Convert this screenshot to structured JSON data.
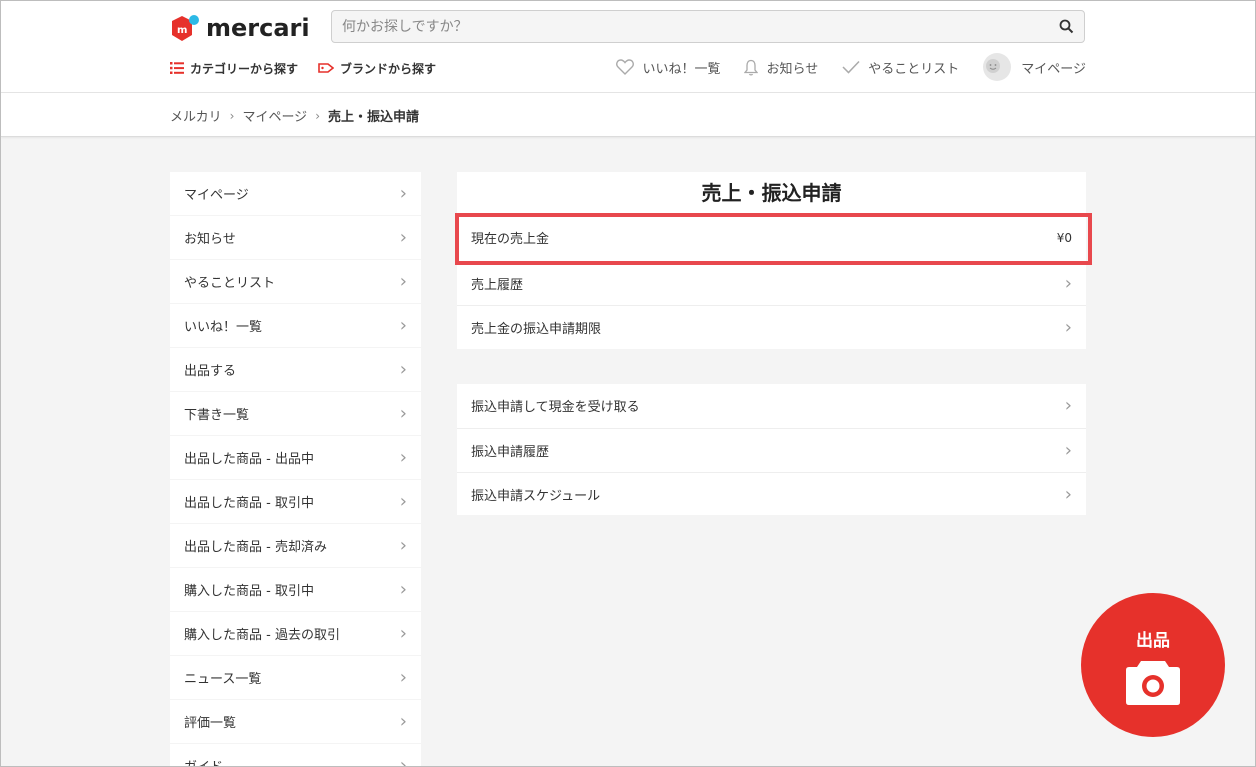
{
  "header": {
    "logo_text": "mercari",
    "search_placeholder": "何かお探しですか？",
    "nav": [
      {
        "label": "カテゴリーから探す",
        "icon": "list-icon"
      },
      {
        "label": "ブランドから探す",
        "icon": "tag-icon"
      }
    ],
    "user_nav": [
      {
        "label": "いいね！一覧",
        "icon": "heart-icon"
      },
      {
        "label": "お知らせ",
        "icon": "bell-icon"
      },
      {
        "label": "やることリスト",
        "icon": "check-icon"
      },
      {
        "label": "マイページ",
        "icon": "avatar-icon"
      }
    ]
  },
  "breadcrumb": [
    "メルカリ",
    "マイページ",
    "売上・振込申請"
  ],
  "sidebar": {
    "items": [
      "マイページ",
      "お知らせ",
      "やることリスト",
      "いいね！一覧",
      "出品する",
      "下書き一覧",
      "出品した商品 - 出品中",
      "出品した商品 - 取引中",
      "出品した商品 - 売却済み",
      "購入した商品 - 取引中",
      "購入した商品 - 過去の取引",
      "ニュース一覧",
      "評価一覧",
      "ガイド"
    ]
  },
  "main": {
    "title": "売上・振込申請",
    "section1": [
      {
        "label": "現在の売上金",
        "value": "¥0"
      },
      {
        "label": "売上履歴"
      },
      {
        "label": "売上金の振込申請期限"
      }
    ],
    "section2": [
      {
        "label": "振込申請して現金を受け取る"
      },
      {
        "label": "振込申請履歴"
      },
      {
        "label": "振込申請スケジュール"
      }
    ]
  },
  "sell_button": {
    "label": "出品",
    "icon": "camera-icon"
  },
  "colors": {
    "brand_red": "#e6312b",
    "highlight": "#e8484d"
  }
}
